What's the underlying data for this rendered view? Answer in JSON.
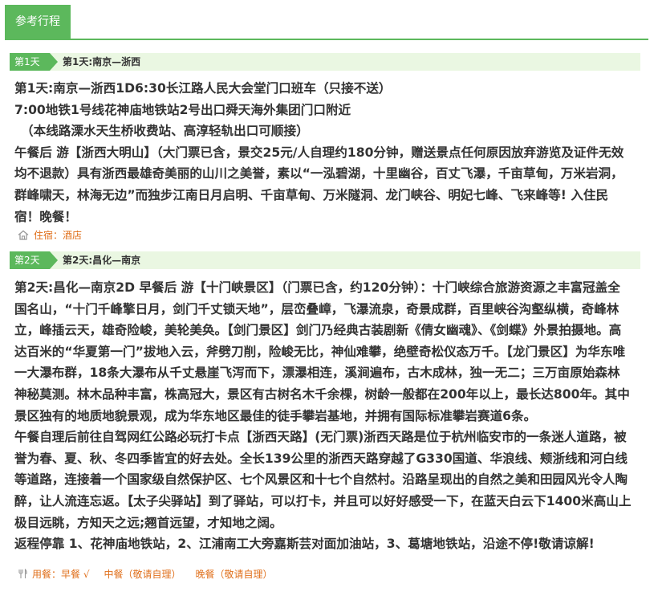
{
  "tab": {
    "label": "参考行程"
  },
  "days": [
    {
      "badge": "第1天",
      "title": "第1天:南京—浙西",
      "lines": [
        "第1天:南京—浙西1D6:30长江路人民大会堂门口班车（只接不送）",
        "7:00地铁1号线花神庙地铁站2号出口舜天海外集团门口附近",
        "（本线路溧水天生桥收费站、高淳轻轨出口可顺接）",
        "午餐后 游【浙西大明山】（大门票已含，景交25元/人自理约180分钟，赠送景点任何原因放弃游览及证件无效均不退款）具有浙西最雄奇美丽的山川之美誉，素以“一泓碧湖，十里幽谷，百丈飞瀑，千亩草甸，万米岩洞，群峰啸天，林海无边”而独步江南日月启明、千亩草甸、万米隧洞、龙门峡谷、明妃七峰、飞来峰等! 入住民宿！晚餐！"
      ],
      "meta_icon": "house-icon",
      "meta": [
        "住宿：酒店"
      ]
    },
    {
      "badge": "第2天",
      "title": "第2天:昌化—南京",
      "lines": [
        "第2天:昌化—南京2D 早餐后 游【十门峡景区】（门票已含，约120分钟）：十门峡综合旅游资源之丰富冠盖全国名山，“十门千峰擎日月，剑门千丈锁天地”，层峦叠嶂，飞瀑流泉，奇景成群，百里峡谷沟壑纵横，奇峰林立，峰插云天，雄奇险峻，美轮美奂。【剑门景区】剑门乃经典古装剧新《倩女幽魂》、《剑蝶》外景拍摄地。高达百米的“华夏第一门”拔地入云，斧劈刀削，险峻无比，神仙难攀，绝壁奇松仪态万千。【龙门景区】为华东唯一大瀑布群，18条大瀑布从千丈悬崖飞泻而下，漂瀑相连，溪涧遍布，古木成林，独一无二；三万亩原始森林神秘莫测。林木品种丰富，株高冠大，景区有古树名木千余棵，树龄一般都在200年以上，最长达800年。其中景区独有的地质地貌景观，成为华东地区最佳的徒手攀岩基地，并拥有国际标准攀岩赛道6条。",
        "午餐自理后前往自驾网红公路必玩打卡点【浙西天路】(无门票)浙西天路是位于杭州临安市的一条迷人道路，被誉为春、夏、秋、冬四季皆宜的好去处。全长139公里的浙西天路穿越了G330国道、华浪线、颊浙线和河白线等道路，连接着一个国家级自然保护区、七个风景区和十七个自然村。沿路呈现出的自然之美和田园风光令人陶醉，让人流连忘返。【太子尖驿站】到了驿站，可以打卡，并且可以好好感受一下，在蓝天白云下1400米高山上极目远眺，方知天之远;翘首远望，才知地之阔。",
        "返程停靠 1、花神庙地铁站，2、江浦南工大旁嘉斯芸对面加油站，3、葛塘地铁站，沿途不停!敬请谅解!"
      ],
      "meta_icon": "fork-knife-icon",
      "meta": [
        "用餐：早餐 √",
        "中餐（敬请自理）",
        "晚餐（敬请自理）"
      ]
    }
  ]
}
